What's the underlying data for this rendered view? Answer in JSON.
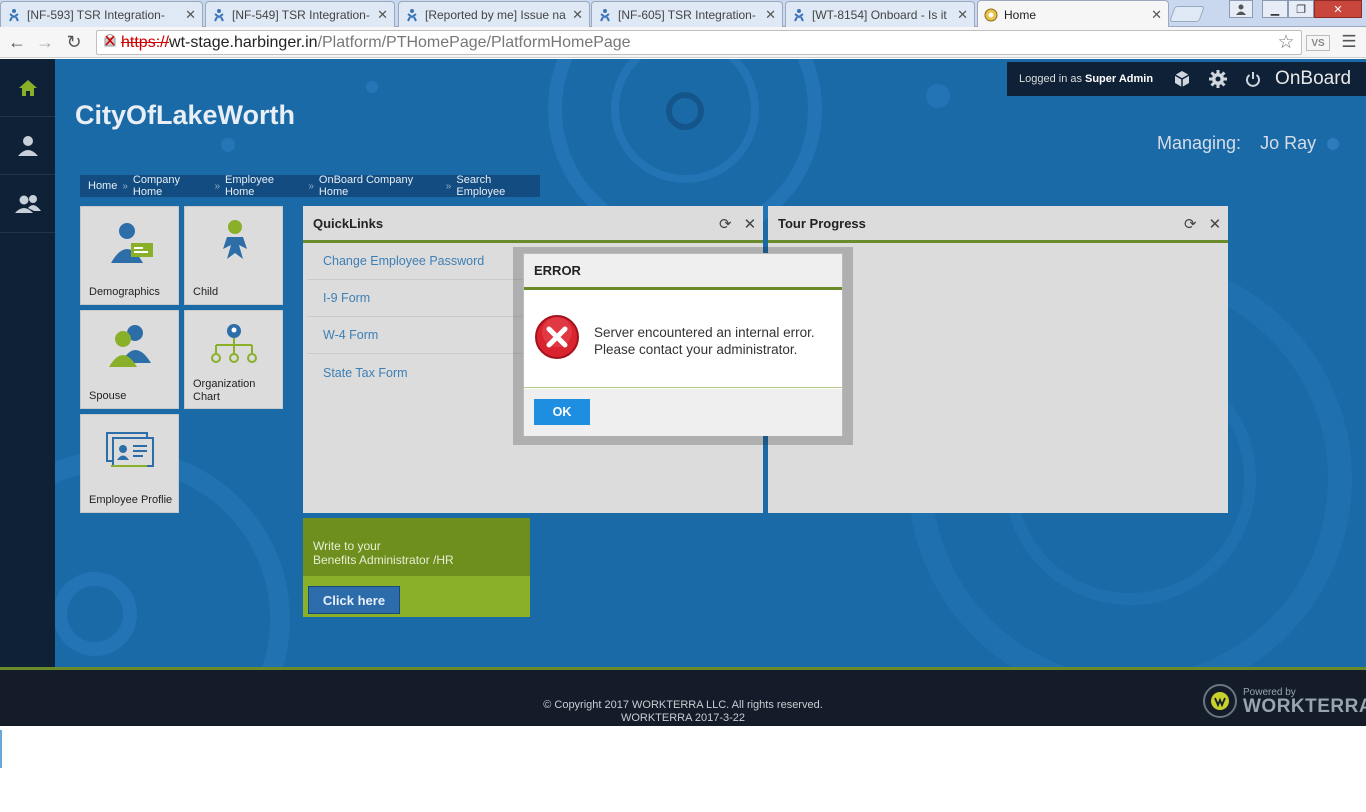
{
  "browser": {
    "tabs": [
      {
        "title": "[NF-593] TSR Integration-"
      },
      {
        "title": "[NF-549] TSR Integration-"
      },
      {
        "title": "[Reported by me] Issue na"
      },
      {
        "title": "[NF-605] TSR Integration-"
      },
      {
        "title": "[WT-8154] Onboard - Is it"
      },
      {
        "title": "Home"
      }
    ],
    "url": {
      "scheme": "https://",
      "host": "wt-stage.harbinger.in",
      "path": "/Platform/PTHomePage/PlatformHomePage"
    },
    "ext_label": "VS"
  },
  "header": {
    "logged_in_prefix": "Logged in as",
    "user": "Super Admin",
    "brand": "OnBoard",
    "company": "CityOfLakeWorth",
    "managing_label": "Managing:",
    "managing_name": "Jo Ray"
  },
  "breadcrumb": [
    "Home",
    "Company Home",
    "Employee Home",
    "OnBoard Company Home",
    "Search Employee"
  ],
  "breadcrumb_sep": "»",
  "tiles": [
    {
      "label": "Demographics"
    },
    {
      "label": "Child"
    },
    {
      "label": "Spouse"
    },
    {
      "label": "Organization Chart"
    },
    {
      "label": "Employee Proflie"
    }
  ],
  "quicklinks": {
    "title": "QuickLinks",
    "links": [
      "Change Employee Password",
      "I-9 Form",
      "W-4 Form",
      "State Tax Form"
    ]
  },
  "tour": {
    "title": "Tour Progress"
  },
  "benefits": {
    "line1": "Write to your",
    "line2": "Benefits Administrator /HR",
    "button": "Click here"
  },
  "dialog": {
    "title": "ERROR",
    "line1": "Server encountered an internal error.",
    "line2": "Please contact your administrator.",
    "ok": "OK"
  },
  "footer": {
    "copyright": "© Copyright 2017 WORKTERRA LLC. All rights reserved.",
    "version": "WORKTERRA 2017-3-22",
    "powered_by": "Powered by",
    "powered_brand": "WORKTERRA"
  },
  "colors": {
    "app_bg": "#1a6aa8",
    "nav_dark": "#0f2137",
    "accent_green": "#6a8b2a",
    "link_blue": "#3d7fb5",
    "ok_blue": "#1e8ee0",
    "error_red": "#d9232e"
  }
}
